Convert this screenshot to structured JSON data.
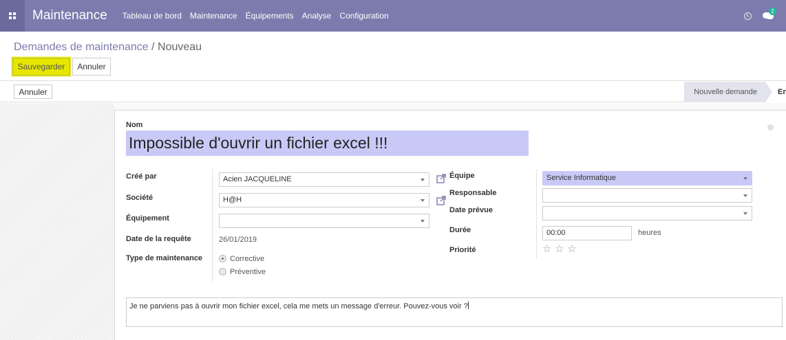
{
  "navbar": {
    "app_name": "Maintenance",
    "menu": [
      "Tableau de bord",
      "Maintenance",
      "Équipements",
      "Analyse",
      "Configuration"
    ],
    "chat_badge": "2",
    "bg_color": "#7c7bad"
  },
  "breadcrumb": {
    "parent": "Demandes de maintenance",
    "separator": " / ",
    "current": "Nouveau"
  },
  "actions": {
    "save": "Sauvegarder",
    "discard": "Annuler"
  },
  "statusbar": {
    "cancel": "Annuler",
    "stage_active": "Nouvelle demande",
    "stage_next": "En cours"
  },
  "form": {
    "name_label": "Nom",
    "name_value": "Impossible d'ouvrir un fichier excel !!!",
    "left": {
      "created_by": {
        "label": "Créé par",
        "value": "Acien JACQUELINE"
      },
      "company": {
        "label": "Société",
        "value": "H@H"
      },
      "equipment": {
        "label": "Équipement",
        "value": ""
      },
      "request_date": {
        "label": "Date de la requête",
        "value": "26/01/2019"
      },
      "maintenance_type": {
        "label": "Type de maintenance",
        "options": [
          "Corrective",
          "Préventive"
        ],
        "selected": "Corrective"
      }
    },
    "right": {
      "team": {
        "label": "Équipe",
        "value": "Service Informatique"
      },
      "responsible": {
        "label": "Responsable",
        "value": ""
      },
      "scheduled_date": {
        "label": "Date prévue",
        "value": ""
      },
      "duration": {
        "label": "Durée",
        "value": "00:00",
        "unit": "heures"
      },
      "priority": {
        "label": "Priorité",
        "stars": 3,
        "filled": 0
      }
    },
    "description": "Je ne parviens pas à ouvrir mon fichier excel, cela me mets un message d'erreur. Pouvez-vous voir ?"
  }
}
